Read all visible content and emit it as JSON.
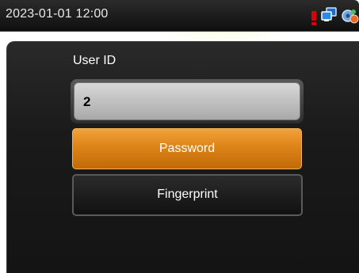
{
  "status_bar": {
    "datetime": "2023-01-01 12:00",
    "icons": [
      "alert-icon",
      "network-icon",
      "gear-icon"
    ]
  },
  "form": {
    "user_id_label": "User ID",
    "user_id_value": "2"
  },
  "buttons": {
    "password_label": "Password",
    "fingerprint_label": "Fingerprint"
  },
  "colors": {
    "accent": "#dd8418",
    "alert": "#e00000",
    "background": "#141414"
  }
}
